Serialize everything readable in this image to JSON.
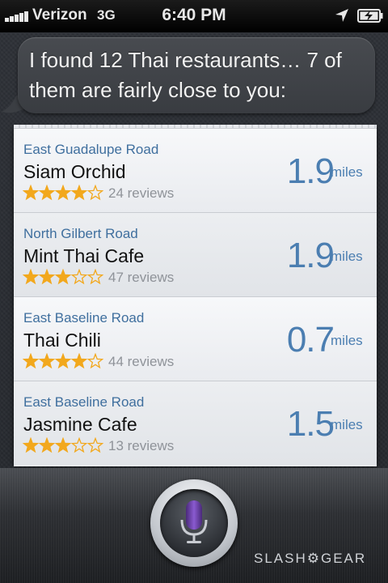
{
  "status_bar": {
    "carrier": "Verizon",
    "network": "3G",
    "time": "6:40 PM",
    "icons": [
      "signal-bars-icon",
      "location-arrow-icon",
      "battery-charging-icon"
    ]
  },
  "siri": {
    "response": "I found 12 Thai restaurants… 7 of them are fairly close to you:"
  },
  "results": [
    {
      "road": "East Guadalupe Road",
      "name": "Siam Orchid",
      "rating": 4,
      "max_rating": 5,
      "reviews": "24 reviews",
      "distance": "1.9",
      "unit": "miles"
    },
    {
      "road": "North Gilbert Road",
      "name": "Mint Thai Cafe",
      "rating": 3,
      "max_rating": 5,
      "reviews": "47 reviews",
      "distance": "1.9",
      "unit": "miles"
    },
    {
      "road": "East Baseline Road",
      "name": "Thai Chili",
      "rating": 4,
      "max_rating": 5,
      "reviews": "44 reviews",
      "distance": "0.7",
      "unit": "miles"
    },
    {
      "road": "East Baseline Road",
      "name": "Jasmine Cafe",
      "rating": 3,
      "max_rating": 5,
      "reviews": "13 reviews",
      "distance": "1.5",
      "unit": "miles"
    }
  ],
  "mic": {
    "icon": "microphone-icon",
    "color": "#6b3fa0"
  },
  "watermark": "SLASH⚙GEAR",
  "colors": {
    "road": "#3f6f9e",
    "distance": "#4b7eb1",
    "star": "#f2a81d"
  }
}
